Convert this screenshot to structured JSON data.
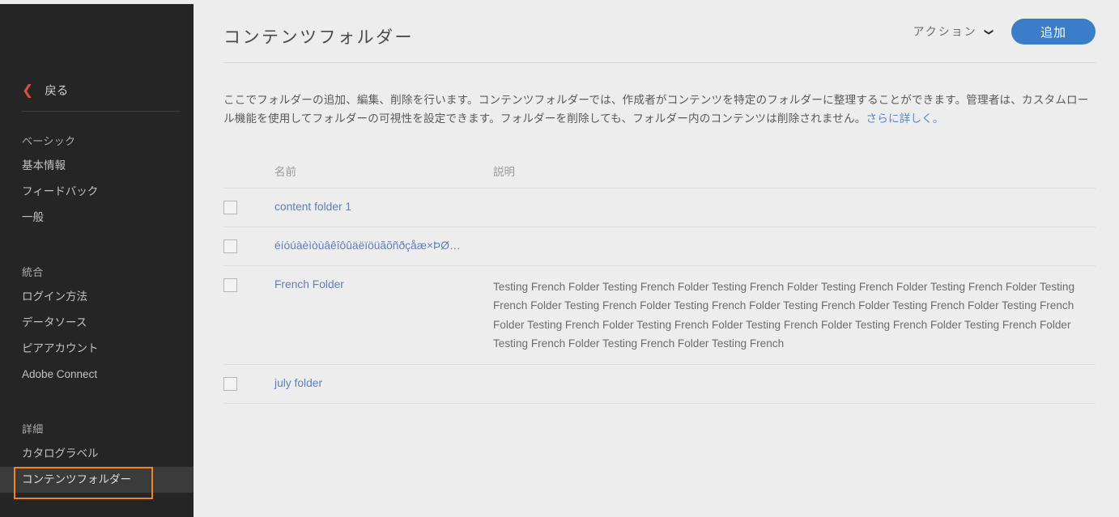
{
  "sidebar": {
    "back_label": "戻る",
    "back_icon": "chevron-left-icon",
    "groups": [
      {
        "title": "ベーシック",
        "items": [
          {
            "label": "基本情報",
            "selected": false
          },
          {
            "label": "フィードバック",
            "selected": false
          },
          {
            "label": "一般",
            "selected": false
          }
        ]
      },
      {
        "title": "統合",
        "items": [
          {
            "label": "ログイン方法",
            "selected": false
          },
          {
            "label": "データソース",
            "selected": false
          },
          {
            "label": "ピアアカウント",
            "selected": false
          },
          {
            "label": "Adobe Connect",
            "selected": false
          }
        ]
      },
      {
        "title": "詳細",
        "items": [
          {
            "label": "カタログラベル",
            "selected": false
          },
          {
            "label": "コンテンツフォルダー",
            "selected": true
          }
        ]
      }
    ]
  },
  "header": {
    "title": "コンテンツフォルダー",
    "actions_label": "アクション",
    "actions_icon": "chevron-down-icon",
    "add_label": "追加",
    "accent_color": "#3a7dc9",
    "highlight_color": "#f58220"
  },
  "description": {
    "text": "ここでフォルダーの追加、編集、削除を行います。コンテンツフォルダーでは、作成者がコンテンツを特定のフォルダーに整理することができます。管理者は、カスタムロール機能を使用してフォルダーの可視性を設定できます。フォルダーを削除しても、フォルダー内のコンテンツは削除されません。",
    "link_label": "さらに詳しく。"
  },
  "table": {
    "columns": {
      "name": "名前",
      "description": "説明"
    },
    "rows": [
      {
        "checked": false,
        "name": "content folder 1",
        "description": ""
      },
      {
        "checked": false,
        "name": "éíóúàèìòùâêîôûäëïöüãõñðçåæ×ÞØ…",
        "description": ""
      },
      {
        "checked": false,
        "name": "French Folder",
        "description": "Testing French Folder Testing French Folder Testing French Folder Testing French Folder Testing French Folder Testing French Folder Testing French Folder Testing French Folder Testing French Folder Testing French Folder Testing French Folder Testing French Folder Testing French Folder Testing French Folder Testing French Folder Testing French Folder Testing French Folder Testing French Folder Testing French"
      },
      {
        "checked": false,
        "name": "july folder",
        "description": ""
      }
    ]
  }
}
